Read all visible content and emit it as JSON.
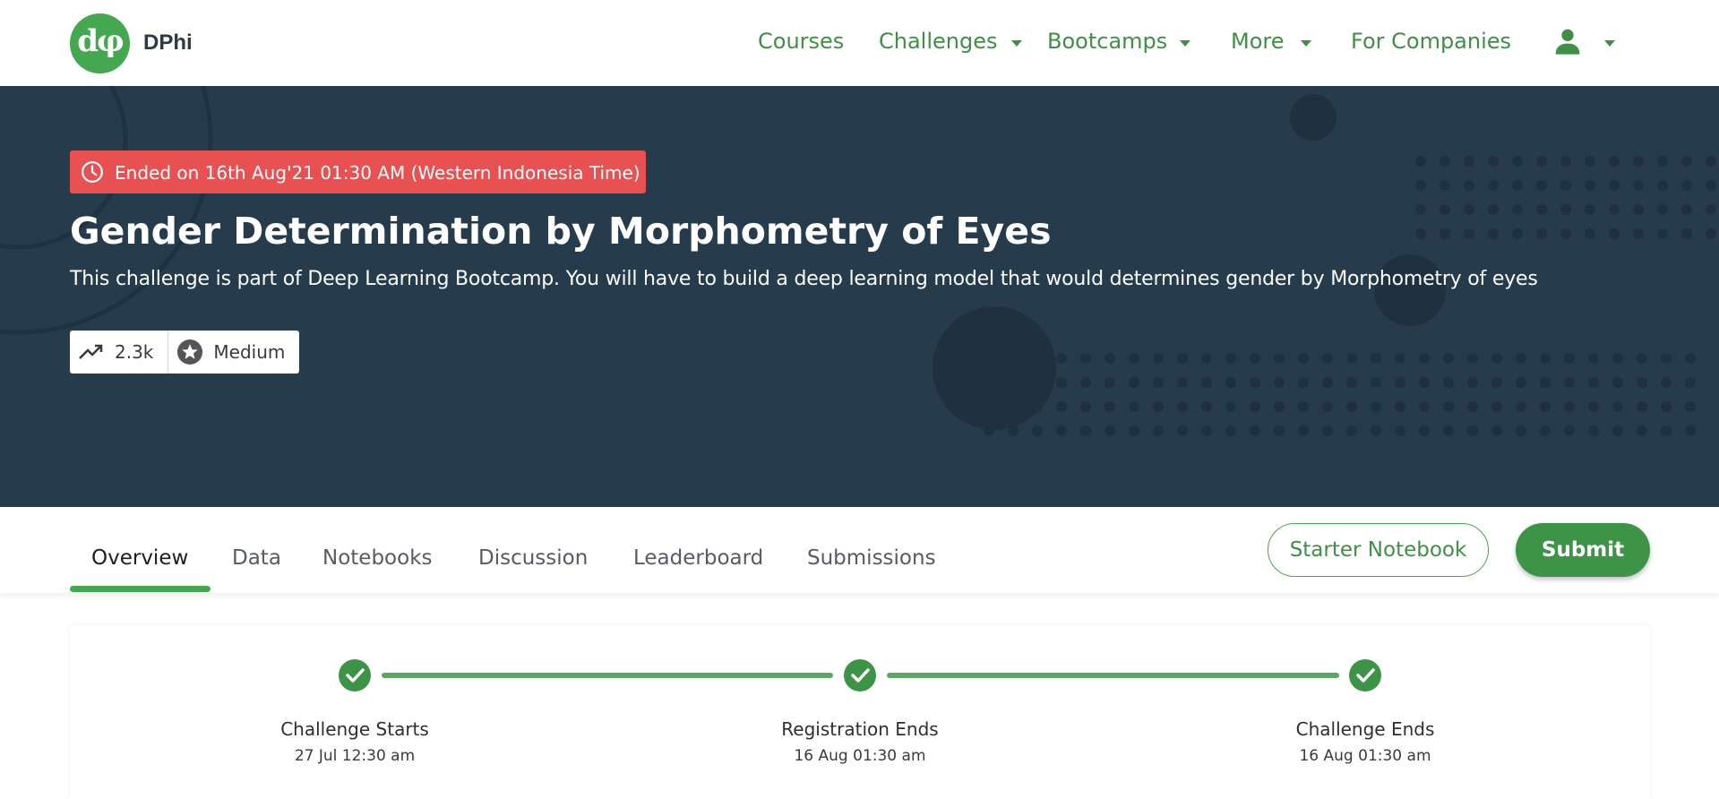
{
  "brand": {
    "logo_glyph": "dφ",
    "name": "DPhi",
    "color": "#45a851"
  },
  "nav": {
    "courses": "Courses",
    "challenges": "Challenges",
    "bootcamps": "Bootcamps",
    "more": "More",
    "for_companies": "For Companies",
    "user_icon": "user-icon",
    "caret_icon": "caret-down-icon"
  },
  "hero": {
    "background": "#263b4c",
    "status_badge": "Ended on 16th Aug'21 01:30 AM (Western Indonesia Time)",
    "status_color": "#e85151",
    "title": "Gender Determination by Morphometry of Eyes",
    "description": "This challenge is part of Deep Learning Bootcamp. You will have to build a deep learning model that would determines gender by Morphometry of eyes",
    "stats": {
      "participants": "2.3k",
      "difficulty": "Medium"
    }
  },
  "tabs": [
    "Overview",
    "Data",
    "Notebooks",
    "Discussion",
    "Leaderboard",
    "Submissions"
  ],
  "active_tab": "Overview",
  "actions": {
    "starter_notebook": "Starter Notebook",
    "submit": "Submit"
  },
  "timeline": [
    {
      "label": "Challenge Starts",
      "date": "27 Jul 12:30 am",
      "status": "done"
    },
    {
      "label": "Registration Ends",
      "date": "16 Aug 01:30 am",
      "status": "done"
    },
    {
      "label": "Challenge Ends",
      "date": "16 Aug 01:30 am",
      "status": "done"
    }
  ]
}
